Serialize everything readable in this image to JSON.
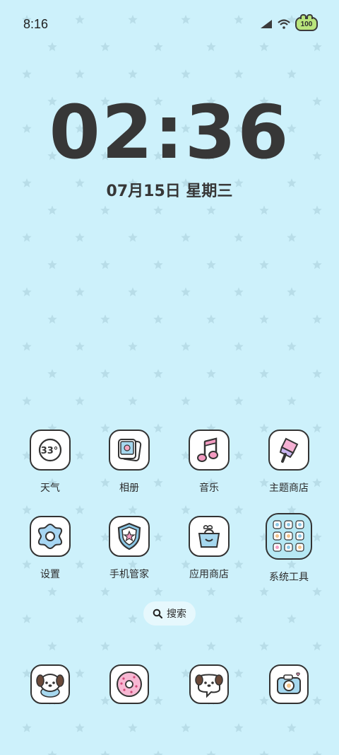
{
  "status_bar": {
    "time": "8:16",
    "battery_level": "100"
  },
  "lockclock": {
    "time": "02:36",
    "date": "07月15日 星期三"
  },
  "apps": [
    {
      "label": "天气",
      "icon": "weather-icon",
      "badge": "33°"
    },
    {
      "label": "相册",
      "icon": "gallery-icon"
    },
    {
      "label": "音乐",
      "icon": "music-icon"
    },
    {
      "label": "主题商店",
      "icon": "theme-store-icon"
    },
    {
      "label": "设置",
      "icon": "settings-icon"
    },
    {
      "label": "手机管家",
      "icon": "security-icon"
    },
    {
      "label": "应用商店",
      "icon": "app-store-icon"
    },
    {
      "label": "系统工具",
      "icon": "system-tools-folder-icon"
    }
  ],
  "search": {
    "label": "搜索"
  },
  "dock": [
    {
      "icon": "puppy-phone-icon"
    },
    {
      "icon": "donut-icon"
    },
    {
      "icon": "puppy-messages-icon"
    },
    {
      "icon": "camera-icon"
    }
  ],
  "colors": {
    "background": "#cdf1fb",
    "star": "#b8dde8",
    "outline": "#333333",
    "battery_fill": "#b9e57c"
  }
}
